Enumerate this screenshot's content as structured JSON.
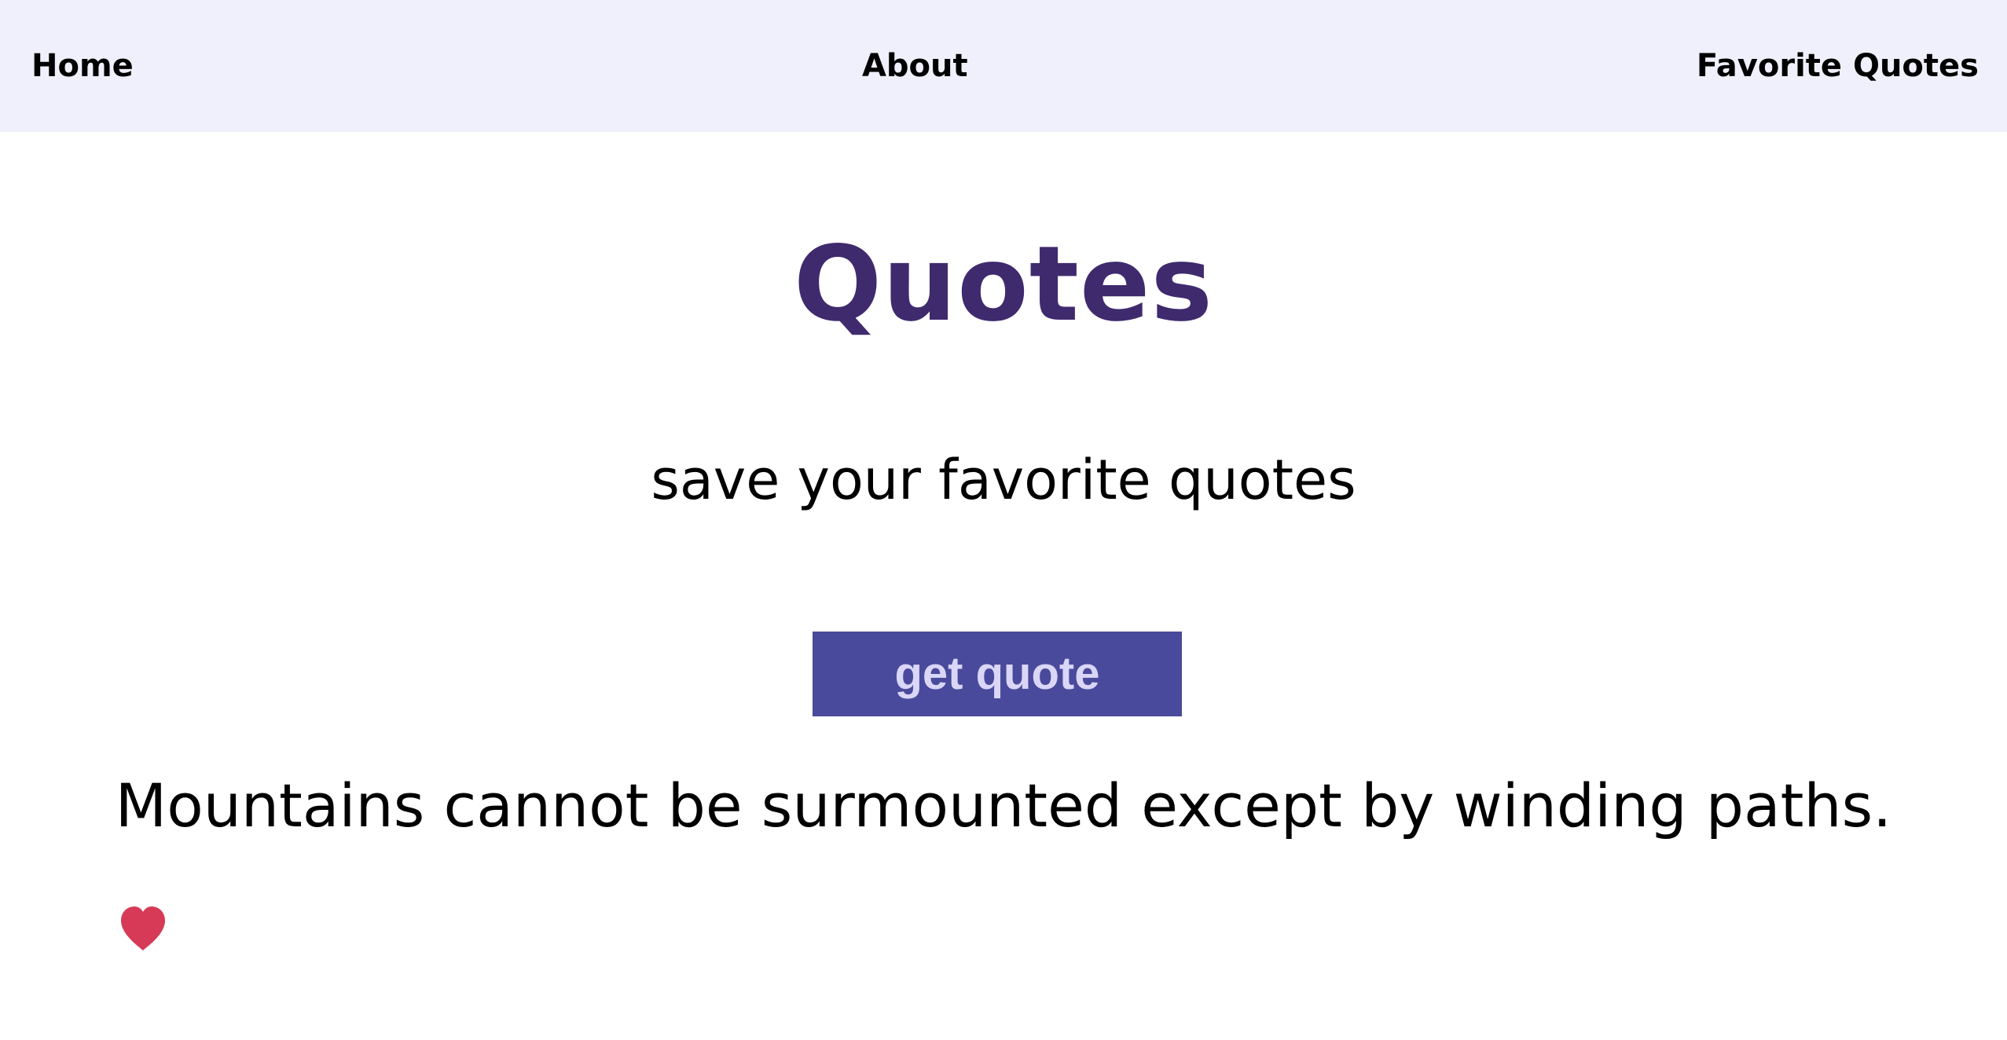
{
  "nav": {
    "home": "Home",
    "about": "About",
    "favorites": "Favorite Quotes"
  },
  "header": {
    "title": "Quotes",
    "subtitle": "save your favorite quotes"
  },
  "actions": {
    "get_quote_label": "get quote"
  },
  "quote": {
    "text": "Mountains cannot be surmounted except by winding paths."
  },
  "icons": {
    "favorite": "heart-icon"
  },
  "colors": {
    "nav_background": "#f0f0fc",
    "title": "#3f2a6e",
    "button_background": "#4a4a9c",
    "button_text": "#d9d6f7",
    "heart": "#d63a56"
  }
}
